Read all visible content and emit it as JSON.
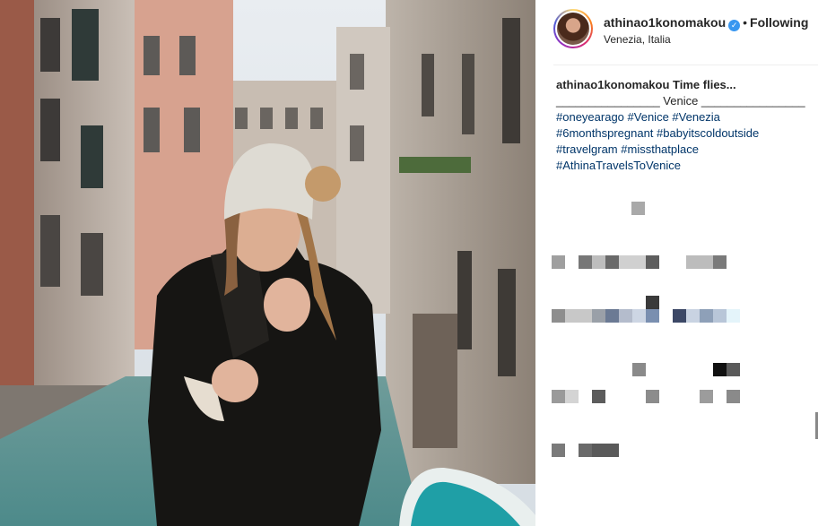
{
  "post": {
    "username": "athinao1konomakou",
    "follow_label": "Following",
    "location": "Venezia, Italia",
    "caption_user": "athinao1konomakou",
    "caption_title": "Time flies...",
    "caption_line2": "________________ Venice ________________",
    "hashtags": {
      "h1": "#oneyearago",
      "h2": "#Venice",
      "h3": "#Venezia",
      "h4": "#6monthspregnant",
      "h5": "#babyitscoldoutside",
      "h6": "#travelgram",
      "h7": "#missthatplace",
      "h8": "#AthinaTravelsToVenice"
    }
  },
  "colors": {
    "link": "#003569",
    "verified": "#3897f0",
    "text": "#262626"
  },
  "icons": {
    "verified": "verified-badge-icon"
  }
}
